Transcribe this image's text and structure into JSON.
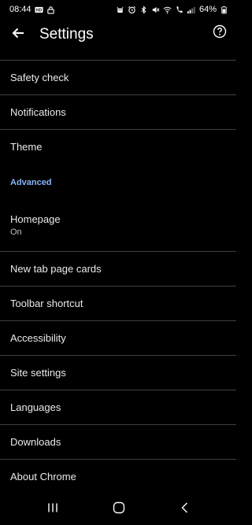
{
  "status_bar": {
    "time": "08:44",
    "battery": "64%",
    "icons": [
      "hd-icon",
      "lock-icon",
      "android-icon",
      "alarm-icon",
      "bluetooth-icon",
      "mute-icon",
      "wifi-icon",
      "call-icon",
      "signal-icon",
      "battery-icon"
    ]
  },
  "app_bar": {
    "title": "Settings",
    "back_icon": "arrow-back-icon",
    "help_icon": "help-circle-icon"
  },
  "menu": {
    "items_top": [
      {
        "label": "Safety check"
      },
      {
        "label": "Notifications"
      },
      {
        "label": "Theme"
      }
    ],
    "section": "Advanced",
    "homepage": {
      "label": "Homepage",
      "status": "On"
    },
    "items_bottom": [
      {
        "label": "New tab page cards"
      },
      {
        "label": "Toolbar shortcut"
      },
      {
        "label": "Accessibility"
      },
      {
        "label": "Site settings"
      },
      {
        "label": "Languages"
      },
      {
        "label": "Downloads"
      },
      {
        "label": "About Chrome"
      }
    ]
  },
  "nav_bar": {
    "icons": [
      "recents-icon",
      "home-icon",
      "back-icon"
    ]
  },
  "colors": {
    "background": "#000000",
    "text": "#e8eaed",
    "accent": "#8ab4f8",
    "divider": "#3c4043"
  }
}
